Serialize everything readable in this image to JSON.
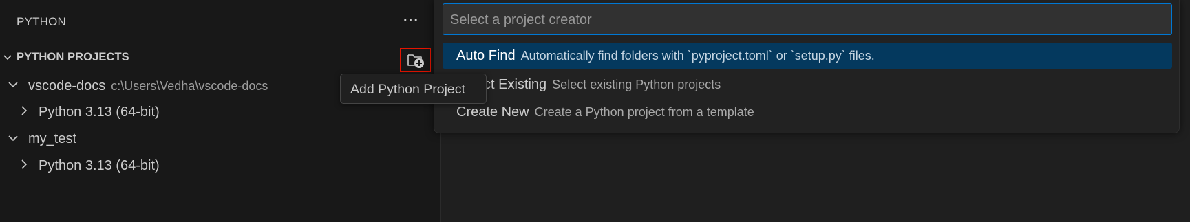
{
  "sidebar": {
    "header": "PYTHON",
    "more_actions": "···",
    "section_title": "PYTHON PROJECTS",
    "add_project_icon": "folder-add-icon",
    "tree": [
      {
        "label": "vscode-docs",
        "description": "c:\\Users\\Vedha\\vscode-docs",
        "expanded": true
      },
      {
        "label": "Python 3.13 (64-bit)",
        "description": "",
        "expanded": false
      },
      {
        "label": "my_test",
        "description": "",
        "expanded": true
      },
      {
        "label": "Python 3.13 (64-bit)",
        "description": "",
        "expanded": false
      }
    ]
  },
  "tooltip": {
    "text": "Add Python Project"
  },
  "quick_pick": {
    "placeholder": "Select a project creator",
    "items": [
      {
        "label": "Auto Find",
        "description": "Automatically find folders with `pyproject.toml` or `setup.py` files.",
        "selected": true
      },
      {
        "label": "Select Existing",
        "description": "Select existing Python projects",
        "selected": false
      },
      {
        "label": "Create New",
        "description": "Create a Python project from a template",
        "selected": false
      }
    ]
  },
  "colors": {
    "accent": "#0078d4",
    "selection": "#04395e",
    "highlight_border": "#e51400"
  }
}
